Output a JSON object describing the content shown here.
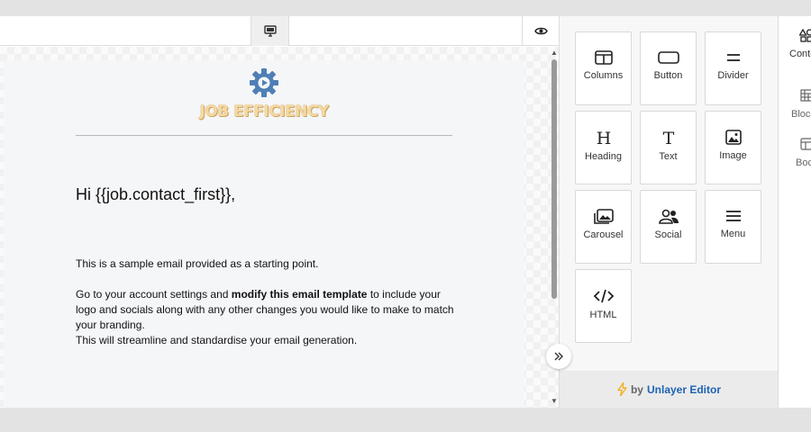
{
  "topbar": {
    "desktop_icon": "desktop-icon",
    "preview_icon": "eye-icon"
  },
  "email": {
    "logo_text": "JOB EFFICIENCY",
    "greeting": "Hi {{job.contact_first}},",
    "paragraph1": "This is a sample email provided as a starting point.",
    "paragraph2_before": "Go to your account settings and ",
    "paragraph2_bold": "modify this email template",
    "paragraph2_after": " to include your logo and socials along with any other changes you would like to make to match your branding.",
    "paragraph3": "This will streamline and standardise your email generation."
  },
  "content_tools": [
    {
      "label": "Columns",
      "icon": "columns-icon"
    },
    {
      "label": "Button",
      "icon": "button-icon"
    },
    {
      "label": "Divider",
      "icon": "divider-icon"
    },
    {
      "label": "Heading",
      "icon": "heading-icon"
    },
    {
      "label": "Text",
      "icon": "text-icon"
    },
    {
      "label": "Image",
      "icon": "image-icon"
    },
    {
      "label": "Carousel",
      "icon": "carousel-icon"
    },
    {
      "label": "Social",
      "icon": "social-icon"
    },
    {
      "label": "Menu",
      "icon": "menu-icon"
    },
    {
      "label": "HTML",
      "icon": "code-icon"
    }
  ],
  "footer": {
    "by": "by",
    "brand": "Unlayer Editor"
  },
  "tabs": [
    {
      "label": "Content",
      "icon": "shapes-icon"
    },
    {
      "label": "Blocks",
      "icon": "blocks-icon"
    },
    {
      "label": "Body",
      "icon": "body-icon"
    }
  ],
  "colors": {
    "accent": "#1d63b4",
    "logo_gear": "#4f7fb5",
    "logo_text": "#f6d8a0",
    "bolt": "#f0b429"
  }
}
